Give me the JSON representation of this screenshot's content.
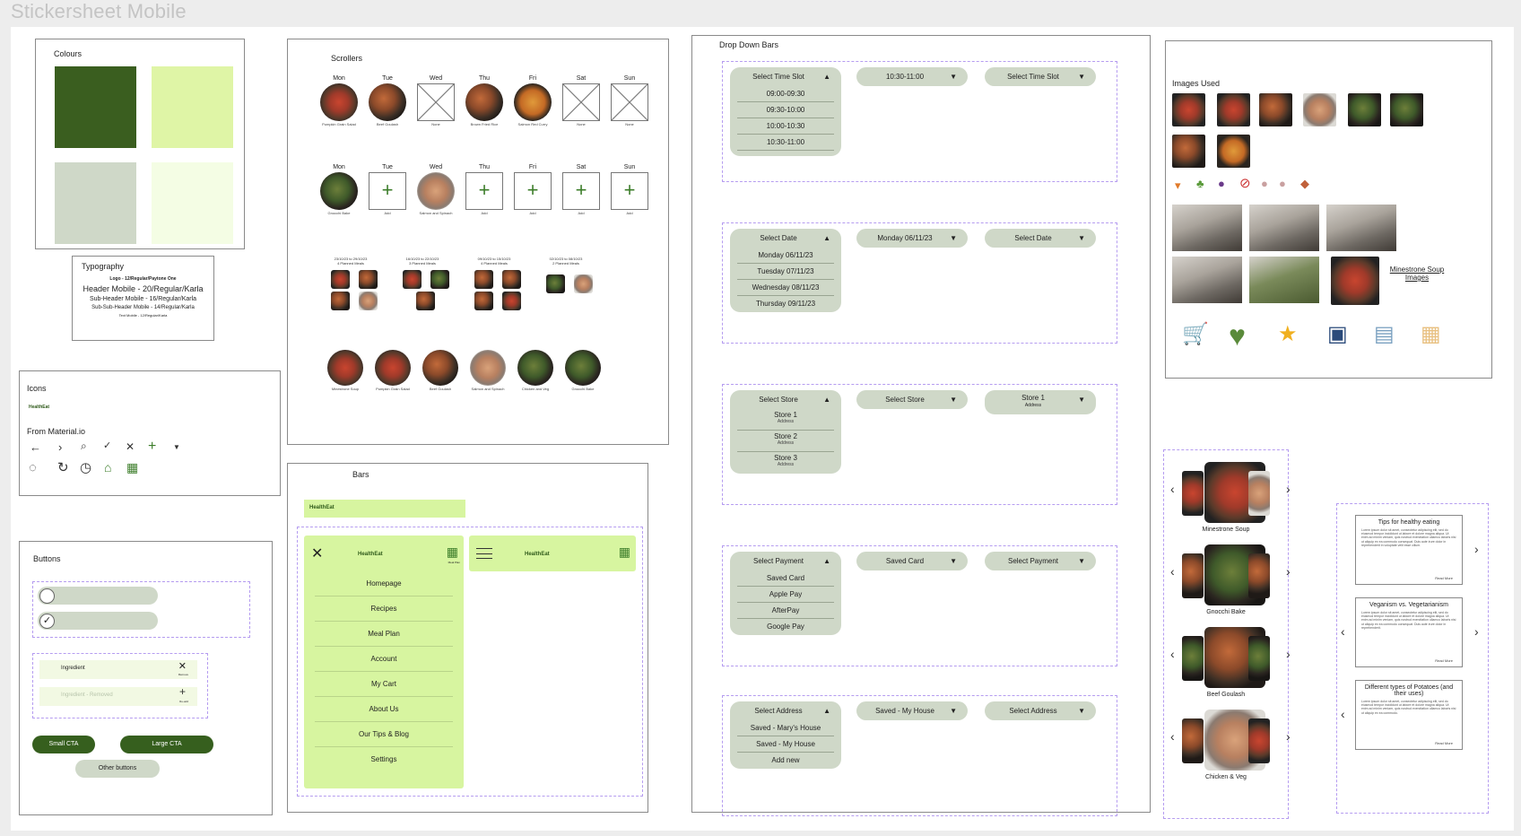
{
  "page_title": "Stickersheet Mobile",
  "colours": {
    "label": "Colours",
    "swatches": [
      "#3a5e1f",
      "#dff5a6",
      "#cfd8c8",
      "#f4fde4"
    ]
  },
  "typography": {
    "label": "Typography",
    "lines": [
      "Logo - 12/Regular/Paytone One",
      "Header Mobile - 20/Regular/Karla",
      "Sub-Header Mobile - 16/Regular/Karla",
      "Sub-Sub-Header Mobile - 14/Regular/Karla",
      "Text Mobile - 12/Regular/Karla"
    ]
  },
  "icons": {
    "label": "Icons",
    "logo": "HealthEat",
    "from": "From Material.io",
    "row1": [
      "arrow-back-icon",
      "chevron-right-icon",
      "search-icon",
      "check-icon",
      "close-icon",
      "add-icon",
      "dropdown-icon"
    ],
    "row2": [
      "apple-icon",
      "refresh-icon",
      "clock-icon",
      "basket-icon",
      "calendar-icon"
    ]
  },
  "buttons": {
    "label": "Buttons",
    "ingredient": "Ingredient",
    "remove": "Remove",
    "ingredient_removed": "Ingredient - Removed",
    "re_add": "Re-add",
    "small_cta": "Small CTA",
    "large_cta": "Large CTA",
    "other": "Other buttons"
  },
  "scrollers": {
    "label": "Scrollers",
    "days": [
      "Mon",
      "Tue",
      "Wed",
      "Thu",
      "Fri",
      "Sat",
      "Sun"
    ],
    "row1_captions": [
      "Pumpkin Grain Salad",
      "Beef Goulash",
      "None",
      "Brown Fried Rice",
      "Salmon Red Curry",
      "None",
      "None"
    ],
    "row2_captions": [
      "Gnocchi Bake",
      "Add",
      "Salmon and Spinach",
      "Add",
      "Add",
      "Add",
      "Add"
    ],
    "planned": [
      {
        "dates": "23/10/23 to 29/10/23",
        "count": "4 Planned Meals"
      },
      {
        "dates": "16/10/23 to 22/10/23",
        "count": "3 Planned Meals"
      },
      {
        "dates": "09/10/23 to 15/10/23",
        "count": "4 Planned Meals"
      },
      {
        "dates": "02/10/23 to 08/10/23",
        "count": "2 Planned Meals"
      }
    ],
    "recipes": [
      "Minestrone Soup",
      "Pumpkin Grain Salad",
      "Beef Goulash",
      "Salmon and Spinach",
      "Chicken and Veg",
      "Gnocchi Bake"
    ]
  },
  "bars": {
    "label": "Bars",
    "menu_items": [
      "Homepage",
      "Recipes",
      "Meal Plan",
      "Account",
      "My Cart",
      "About Us",
      "Our Tips & Blog",
      "Settings"
    ],
    "meal_plan": "Meal Plan"
  },
  "dropdowns": {
    "label": "Drop Down Bars",
    "time": {
      "head": "Select Time Slot",
      "options": [
        "09:00-09:30",
        "09:30-10:00",
        "10:00-10:30",
        "10:30-11:00"
      ],
      "selected": "10:30-11:00",
      "empty": "Select Time Slot"
    },
    "date": {
      "head": "Select Date",
      "options": [
        "Monday 06/11/23",
        "Tuesday 07/11/23",
        "Wednesday 08/11/23",
        "Thursday 09/11/23"
      ],
      "selected": "Monday 06/11/23",
      "empty": "Select Date"
    },
    "store": {
      "head": "Select Store",
      "options": [
        "Store 1",
        "Store 2",
        "Store 3"
      ],
      "sub": "Address",
      "empty": "Select Store",
      "selected": "Store 1"
    },
    "payment": {
      "head": "Select Payment",
      "options": [
        "Saved Card",
        "Apple Pay",
        "AfterPay",
        "Google Pay"
      ],
      "selected": "Saved Card",
      "empty": "Select Payment"
    },
    "address": {
      "head": "Select Address",
      "options": [
        "Saved - Mary's House",
        "Saved - My House",
        "Add new"
      ],
      "selected": "Saved - My House",
      "empty": "Select Address"
    }
  },
  "images_used": {
    "label": "Images Used",
    "soup_label": "Minestrone Soup Images"
  },
  "carousel": {
    "items": [
      "Minestrone Soup",
      "Gnocchi Bake",
      "Beef Goulash",
      "Chicken & Veg"
    ]
  },
  "tips": {
    "cards": [
      {
        "title": "Tips for healthy eating"
      },
      {
        "title": "Veganism vs. Vegetarianism"
      },
      {
        "title": "Different types of Potatoes (and their uses)"
      }
    ],
    "read_more": "Read More"
  }
}
